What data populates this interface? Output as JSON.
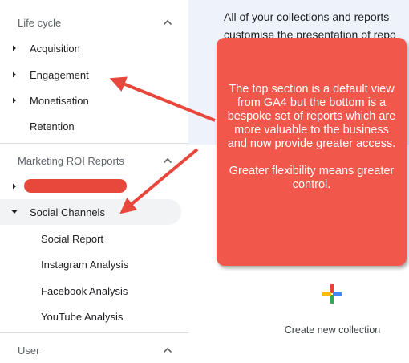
{
  "sidebar": {
    "lifecycle": {
      "header": "Life cycle",
      "items": [
        {
          "label": "Acquisition"
        },
        {
          "label": "Engagement"
        },
        {
          "label": "Monetisation"
        },
        {
          "label": "Retention"
        }
      ]
    },
    "marketing": {
      "header": "Marketing ROI Reports",
      "selected": {
        "label": "Social Channels"
      },
      "subitems": [
        {
          "label": "Social Report"
        },
        {
          "label": "Instagram Analysis"
        },
        {
          "label": "Facebook Analysis"
        },
        {
          "label": "YouTube Analysis"
        }
      ]
    },
    "user": {
      "header": "User"
    }
  },
  "main": {
    "intro_line1": "All of your collections and reports",
    "intro_line2": "customise the presentation of repo",
    "create_label": "Create new collection"
  },
  "callout": {
    "paragraph1": "The top section is a default view from GA4 but the bottom is a bespoke set of reports which are more valuable to the business and now provide greater access.",
    "paragraph2": "Greater flexibility means greater control."
  },
  "colors": {
    "callout": "#f2574c",
    "arrow": "#e8473c",
    "selected_bg": "#f1f3f4",
    "plus_red": "#ea4335",
    "plus_blue": "#4285f4",
    "plus_yellow": "#fbbc04",
    "plus_green": "#34a853"
  }
}
